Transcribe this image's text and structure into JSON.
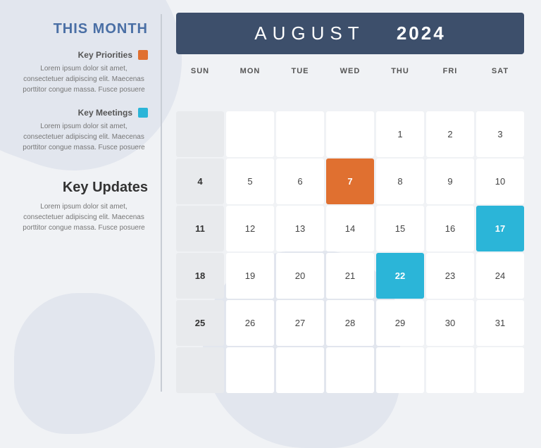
{
  "sidebar": {
    "section_title": "THIS MONTH",
    "priorities": {
      "label": "Key Priorities",
      "text": "Lorem ipsum dolor sit amet,\nconsectetuer adipiscing elit.\nMaecenas porttitor congue\nmassa. Fusce posuere"
    },
    "meetings": {
      "label": "Key Meetings",
      "text": "Lorem ipsum dolor sit amet,\nconsectetuer adipiscing elit.\nMaecenas porttitor congue\nmassa. Fusce posuere"
    },
    "updates": {
      "title": "Key Updates",
      "text": "Lorem ipsum dolor sit amet,\nconsectetuer adipiscing elit.\nMaecenas porttitor congue\nmassa. Fusce posuere"
    }
  },
  "calendar": {
    "month": "AUGUST",
    "year": "2024",
    "day_headers": [
      "SUN",
      "MON",
      "TUE",
      "WED",
      "THU",
      "FRI",
      "SAT"
    ],
    "weeks": [
      {
        "num": null,
        "days": [
          "",
          "",
          "",
          "",
          "1",
          "2",
          "3"
        ]
      },
      {
        "num": "4",
        "days": [
          "",
          "5",
          "6",
          "7",
          "8",
          "9",
          "10"
        ]
      },
      {
        "num": "11",
        "days": [
          "",
          "12",
          "13",
          "14",
          "15",
          "16",
          "17"
        ]
      },
      {
        "num": "18",
        "days": [
          "",
          "19",
          "20",
          "21",
          "22",
          "23",
          "24"
        ]
      },
      {
        "num": "25",
        "days": [
          "",
          "26",
          "27",
          "28",
          "29",
          "30",
          "31"
        ]
      },
      {
        "num": null,
        "days": [
          "",
          "",
          "",
          "",
          "",
          "",
          ""
        ]
      }
    ],
    "highlights": {
      "orange": [
        "7"
      ],
      "blue": [
        "17",
        "22"
      ]
    }
  },
  "colors": {
    "header_bg": "#3d4f6b",
    "orange": "#e07030",
    "blue": "#2bb5d8",
    "sidebar_title": "#4a6fa5",
    "empty_cell": "#e8eaed"
  }
}
